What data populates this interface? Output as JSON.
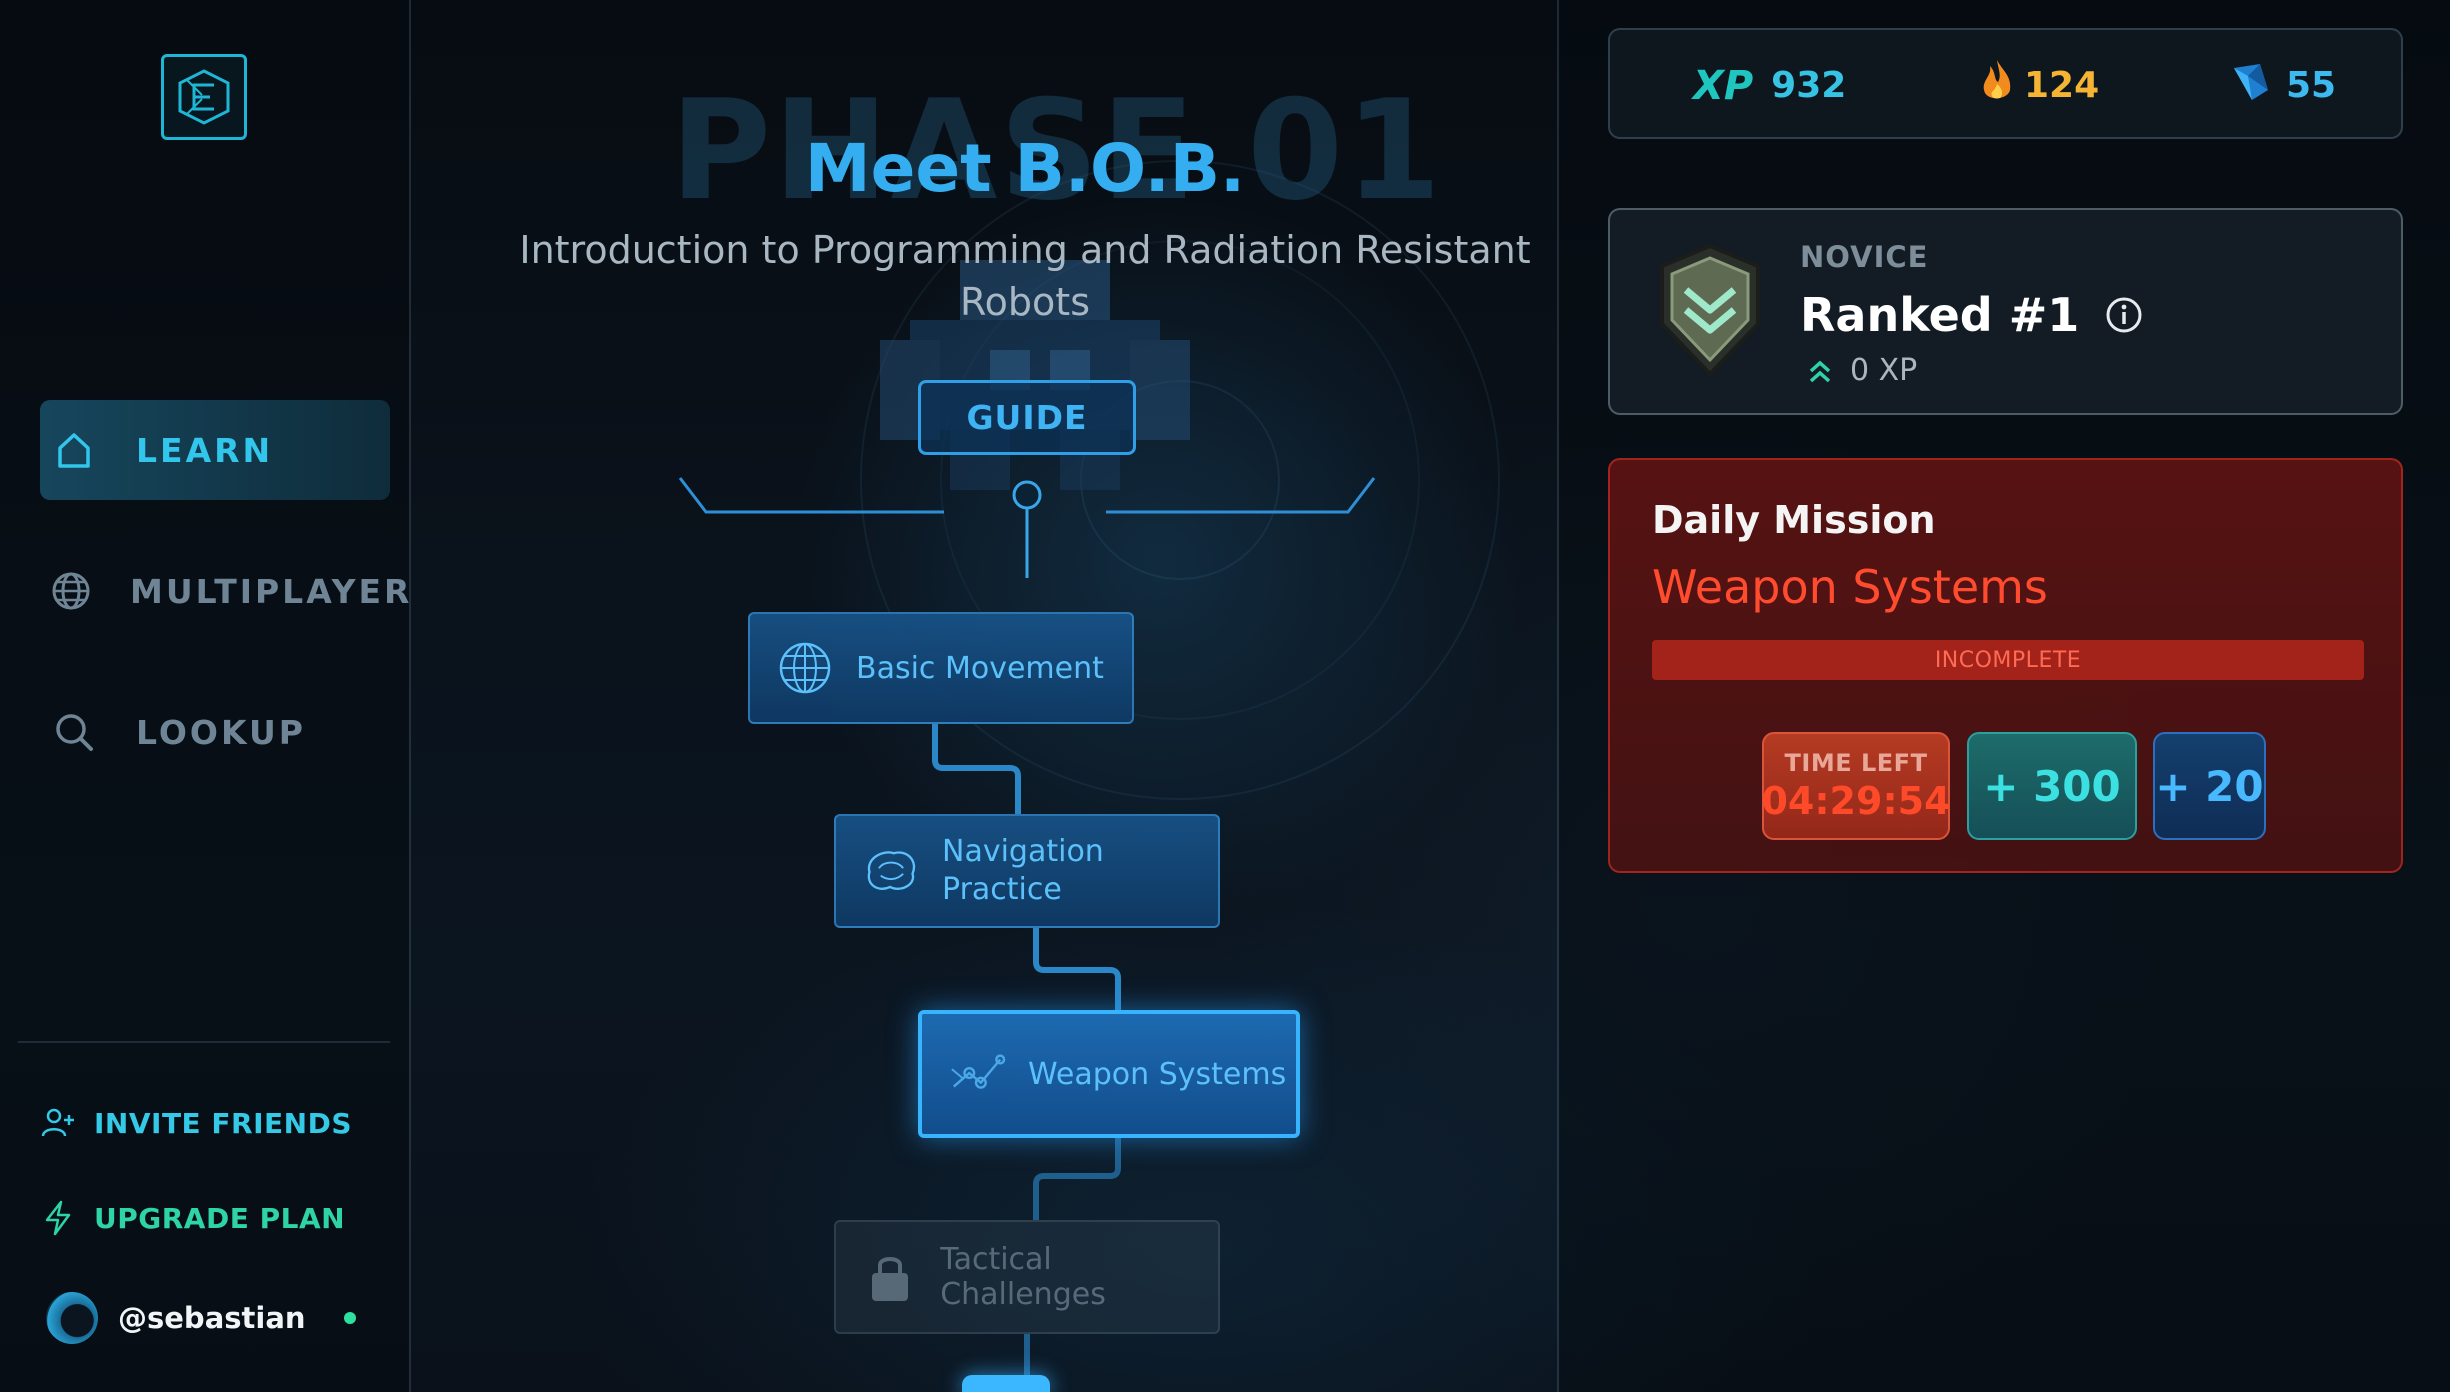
{
  "sidebar": {
    "nav": [
      {
        "label": "LEARN",
        "icon": "home-icon",
        "active": true
      },
      {
        "label": "MULTIPLAYER",
        "icon": "globe-icon",
        "active": false
      },
      {
        "label": "LOOKUP",
        "icon": "search-icon",
        "active": false
      }
    ],
    "invite_label": "INVITE FRIENDS",
    "upgrade_label": "UPGRADE PLAN",
    "username": "@sebastian",
    "online": true
  },
  "course": {
    "phase_watermark": "PHASE 01",
    "title": "Meet B.O.B.",
    "subtitle": "Introduction to Programming and Radiation Resistant Robots",
    "guide_label": "GUIDE",
    "lessons": [
      {
        "label": "Basic Movement",
        "icon": "globe-grid-icon",
        "state": "completed"
      },
      {
        "label": "Navigation Practice",
        "icon": "brain-icon",
        "state": "completed"
      },
      {
        "label": "Weapon Systems",
        "icon": "graph-nodes-icon",
        "state": "current"
      },
      {
        "label": "Tactical Challenges",
        "icon": "lock-icon",
        "state": "locked"
      }
    ]
  },
  "stats": {
    "xp_label": "XP",
    "xp": "932",
    "streak": "124",
    "gems": "55"
  },
  "rank": {
    "tier": "NOVICE",
    "title": "Ranked #1",
    "xp": "0 XP"
  },
  "daily_mission": {
    "heading": "Daily Mission",
    "name": "Weapon Systems",
    "status": "INCOMPLETE",
    "time_left_label": "TIME LEFT",
    "time_left": "04:29:54",
    "reward_xp": "+ 300",
    "reward_gems": "+ 20"
  },
  "colors": {
    "accent": "#34aef0",
    "active_nav": "#33c6ec",
    "mission_red": "#ff4b2e",
    "streak_orange": "#f5b433"
  }
}
